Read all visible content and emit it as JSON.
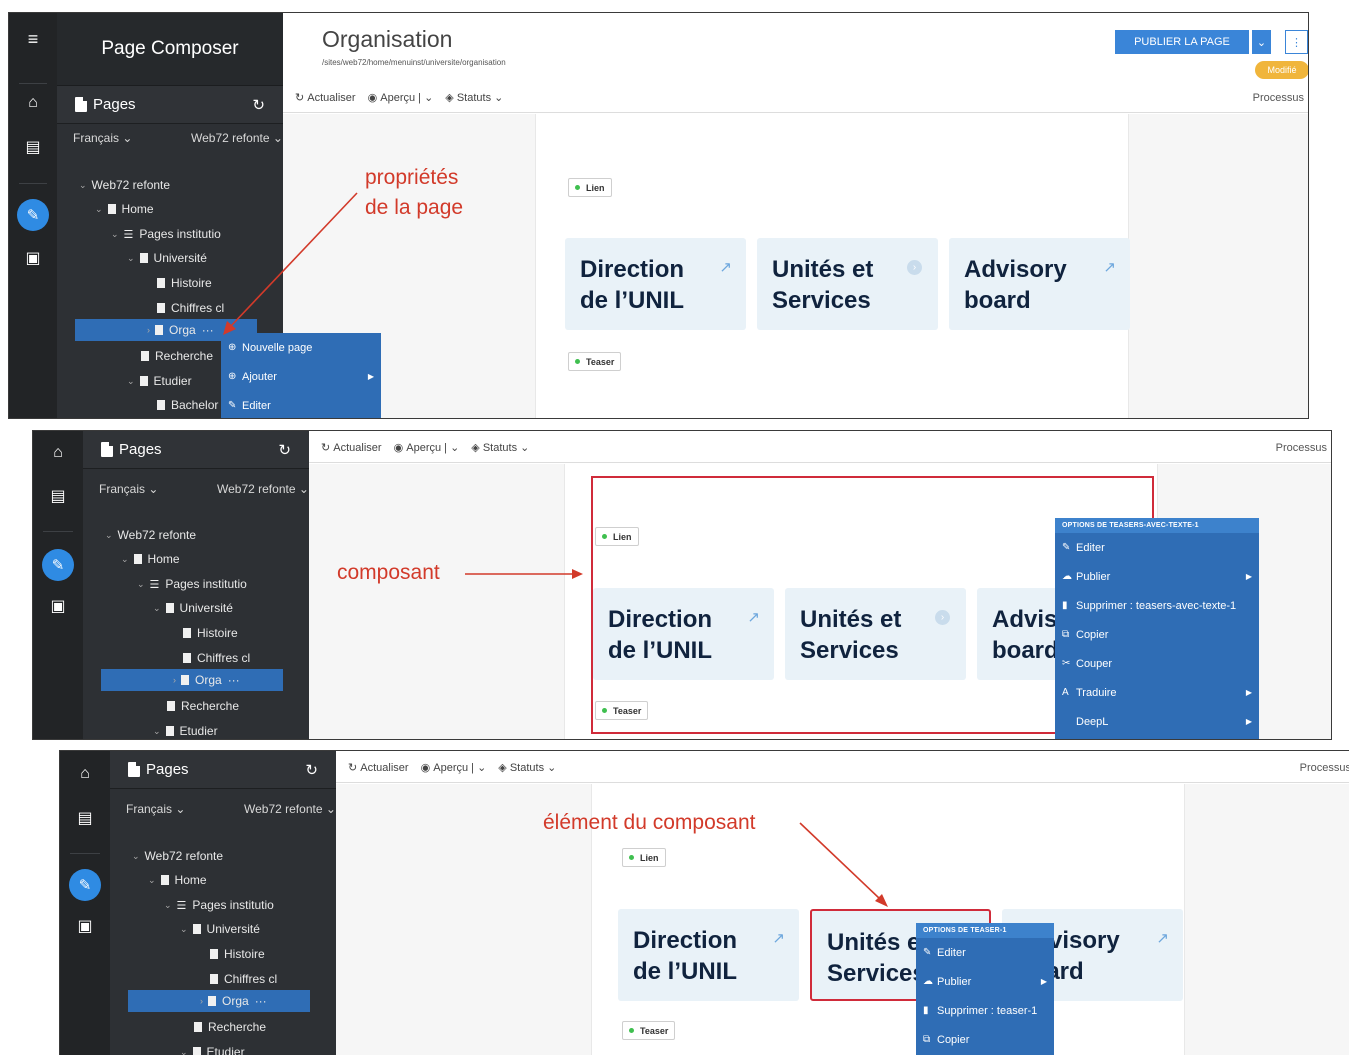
{
  "sidebar": {
    "app_title": "Page Composer",
    "pages_title": "Pages",
    "language": "Français",
    "site": "Web72 refonte",
    "tree": [
      {
        "label": "Web72 refonte"
      },
      {
        "label": "Home"
      },
      {
        "label": "Pages institutio"
      },
      {
        "label": "Université"
      },
      {
        "label": "Histoire"
      },
      {
        "label": "Chiffres cl"
      },
      {
        "label": "Orga"
      },
      {
        "label": "Recherche"
      },
      {
        "label": "Etudier"
      },
      {
        "label": "Bachelor"
      }
    ]
  },
  "header": {
    "page_title": "Organisation",
    "page_path": "/sites/web72/home/menuinst/universite/organisation",
    "publish_label": "PUBLIER LA PAGE",
    "status_badge": "Modifié"
  },
  "toolbar": {
    "refresh": "Actualiser",
    "preview": "Aperçu",
    "status": "Statuts",
    "process": "Processus"
  },
  "content": {
    "tag_link": "Lien",
    "tag_teaser": "Teaser",
    "cards": [
      {
        "title": "Direction\nde l’UNIL",
        "icon": "external-link-icon"
      },
      {
        "title": "Unités et\nServices",
        "icon": "chevron-right-icon"
      },
      {
        "title": "Advisory\nboard",
        "icon": "external-link-icon"
      }
    ]
  },
  "context_menu_page": {
    "items": [
      "Nouvelle page",
      "Ajouter",
      "Editer"
    ]
  },
  "context_menu_component": {
    "header": "OPTIONS DE TEASERS-AVEC-TEXTE-1",
    "items": [
      "Editer",
      "Publier",
      "Supprimer : teasers-avec-texte-1",
      "Copier",
      "Couper",
      "Traduire",
      "DeepL"
    ]
  },
  "context_menu_element": {
    "header": "OPTIONS DE TEASER-1",
    "items": [
      "Editer",
      "Publier",
      "Supprimer : teaser-1",
      "Copier"
    ]
  },
  "annotations": {
    "page_props_1": "propriétés",
    "page_props_2": "de la page",
    "component": "composant",
    "component_element": "élément du composant"
  },
  "colors": {
    "annotation": "#d23a2a",
    "selection": "#2f6db5",
    "accent": "#2f8be3",
    "card_bg": "#e9f2f8"
  }
}
